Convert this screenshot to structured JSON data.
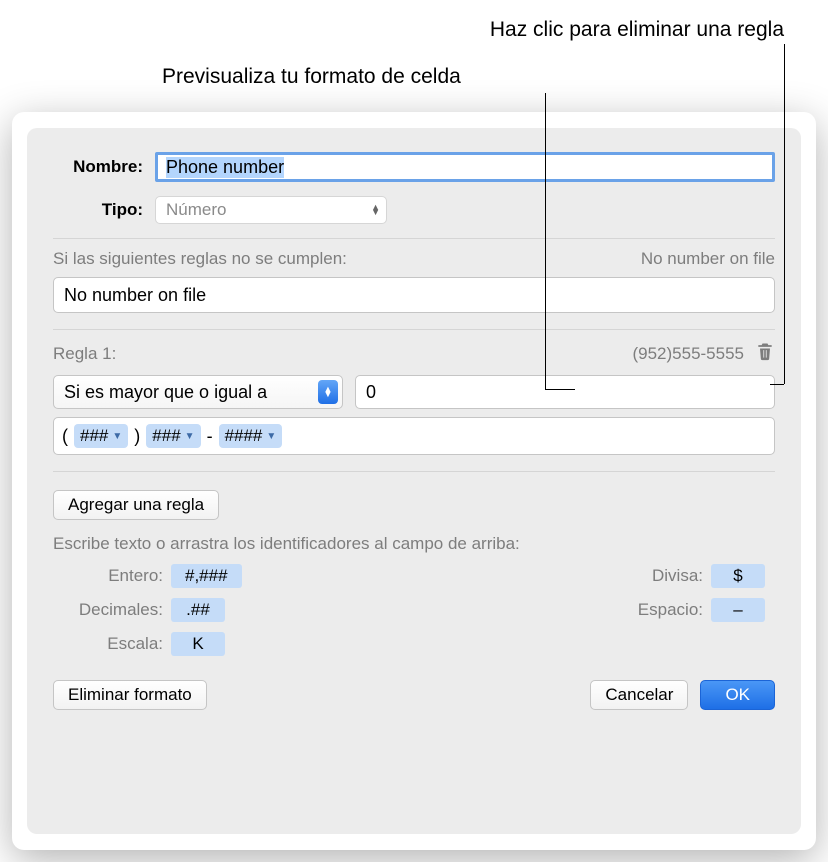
{
  "annotations": {
    "delete_rule": "Haz clic para eliminar una regla",
    "preview_format": "Previsualiza tu formato de celda"
  },
  "labels": {
    "name": "Nombre:",
    "type": "Tipo:"
  },
  "name_value": "Phone number",
  "type_value": "Número",
  "fallback": {
    "intro": "Si las siguientes reglas no se cumplen:",
    "preview": "No number on file",
    "value": "No number on file"
  },
  "rule1": {
    "label": "Regla 1:",
    "preview": "(952)555-5555",
    "condition": "Si es mayor que o igual a",
    "value": "0",
    "format_tokens": {
      "open": "(",
      "t1": "###",
      "close": ")",
      "t2": "###",
      "sep": "-",
      "t3": "####"
    }
  },
  "add_rule": "Agregar una regla",
  "tokens": {
    "intro": "Escribe texto o arrastra los identificadores al campo de arriba:",
    "entero_label": "Entero:",
    "entero_token": "#,###",
    "decimales_label": "Decimales:",
    "decimales_token": ".##",
    "escala_label": "Escala:",
    "escala_token": "K",
    "divisa_label": "Divisa:",
    "divisa_token": "$",
    "espacio_label": "Espacio:",
    "espacio_token": "–"
  },
  "footer": {
    "delete_format": "Eliminar formato",
    "cancel": "Cancelar",
    "ok": "OK"
  }
}
